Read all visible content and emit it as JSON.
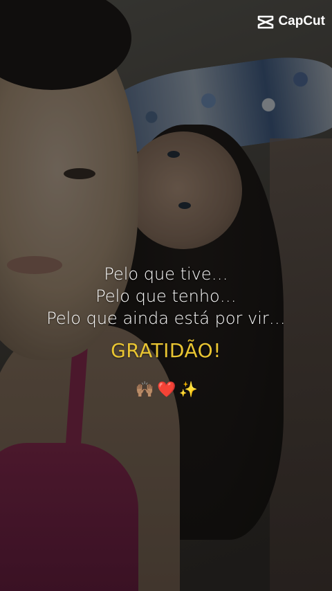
{
  "watermark": {
    "brand": "CapCut",
    "icon": "capcut-logo-icon"
  },
  "caption": {
    "line1": "Pelo que tive…",
    "line2": "Pelo que tenho…",
    "line3": "Pelo que ainda está por vir…",
    "highlight": "GRATIDÃO!",
    "highlight_color": "#e9c532"
  },
  "emojis": [
    {
      "icon": "raised-hands-icon",
      "glyph": "🙌🏽"
    },
    {
      "icon": "red-heart-icon",
      "glyph": "❤️"
    },
    {
      "icon": "sparkles-icon",
      "glyph": "✨"
    }
  ]
}
